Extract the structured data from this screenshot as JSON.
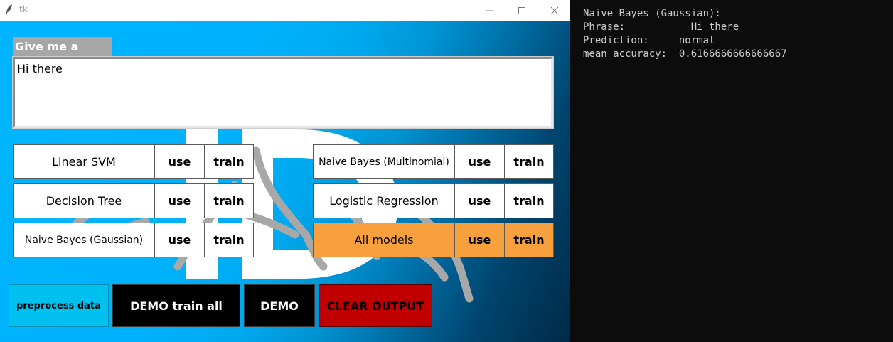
{
  "window": {
    "title": "tk",
    "controls": [
      "minimize-icon",
      "maximize-icon",
      "close-icon"
    ]
  },
  "phrase": {
    "label": "Give me a phrase",
    "value": "Hi there"
  },
  "models_left": [
    {
      "name": "Linear SVM",
      "use_label": "use",
      "train_label": "train"
    },
    {
      "name": "Decision Tree",
      "use_label": "use",
      "train_label": "train"
    },
    {
      "name": "Naive Bayes (Gaussian)",
      "use_label": "use",
      "train_label": "train"
    }
  ],
  "models_right": [
    {
      "name": "Naive Bayes (Multinomial)",
      "use_label": "use",
      "train_label": "train"
    },
    {
      "name": "Logistic Regression",
      "use_label": "use",
      "train_label": "train"
    },
    {
      "name": "All models",
      "use_label": "use",
      "train_label": "train"
    }
  ],
  "bottom": {
    "preprocess_label": "preprocess data",
    "demo_train_all_label": "DEMO train all",
    "demo_label": "DEMO",
    "clear_label": "CLEAR OUTPUT"
  },
  "colors": {
    "background_accent": "#00b4ff",
    "all_models_highlight": "#f9a03e",
    "preprocess_button": "#00c0f0",
    "clear_button": "#c00000",
    "clear_text": "#000000"
  },
  "console": {
    "lines": [
      "Naive Bayes (Gaussian):",
      "Phrase:           Hi there",
      "Prediction:     normal",
      "mean accuracy:  0.6166666666666667"
    ]
  }
}
